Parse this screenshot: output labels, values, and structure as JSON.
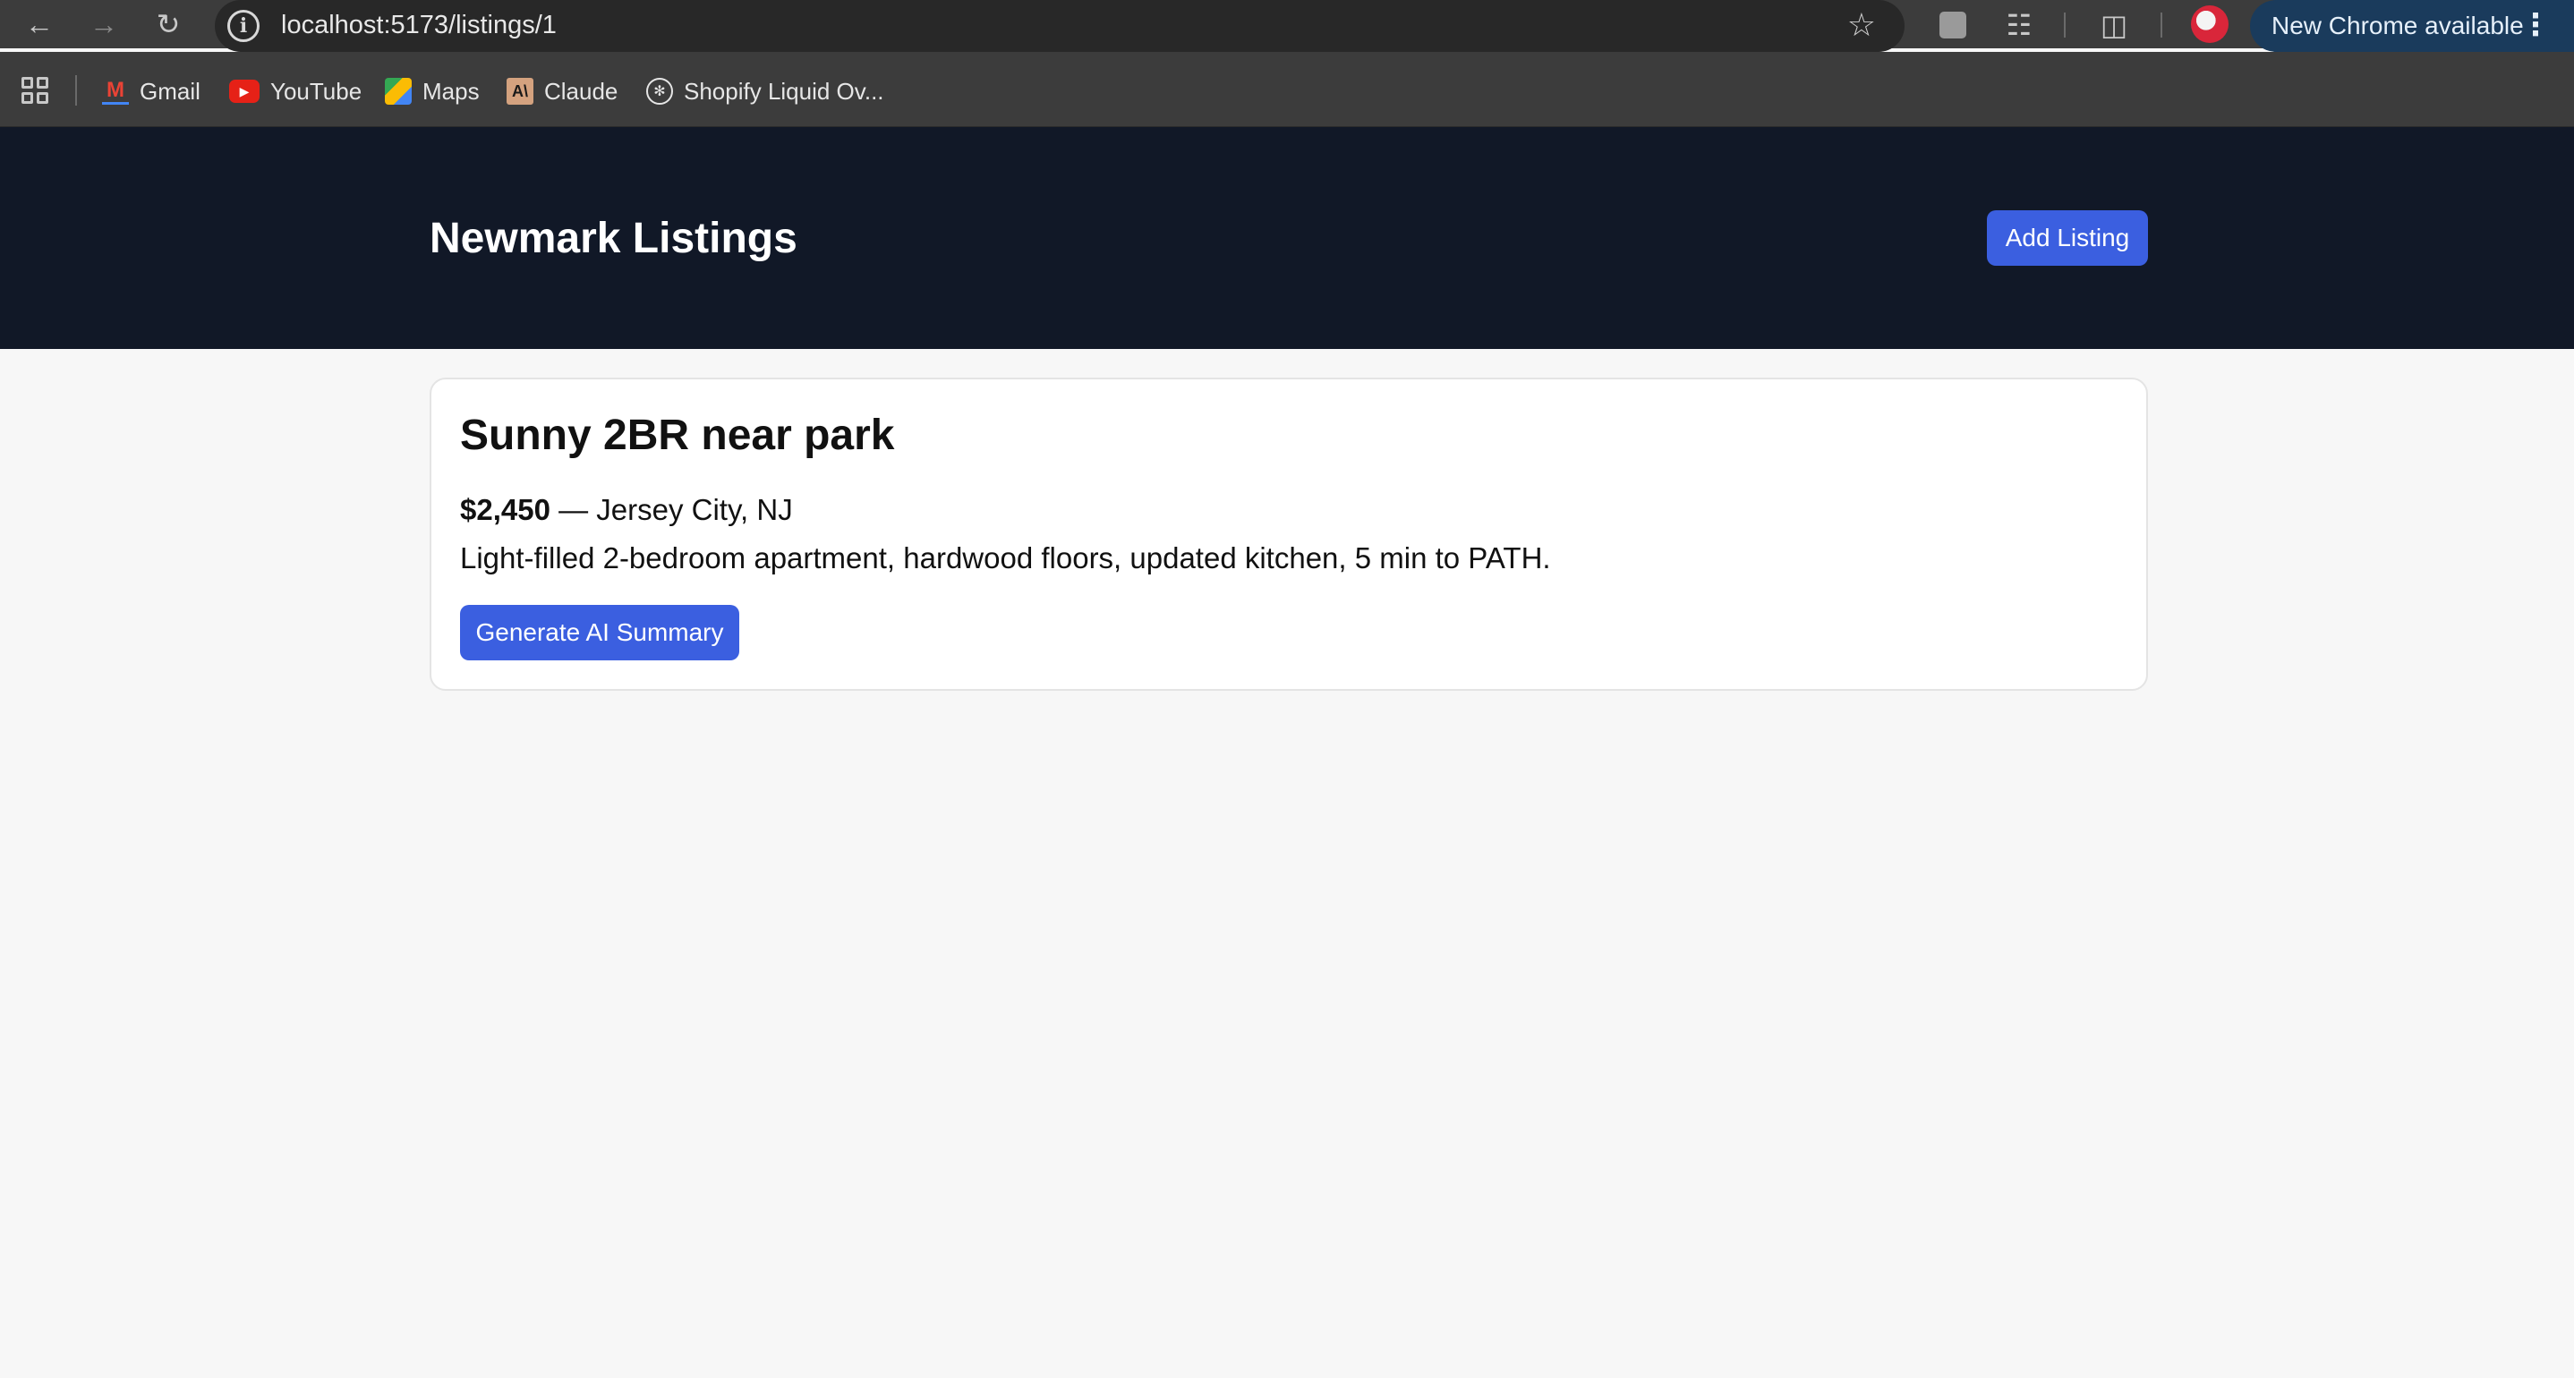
{
  "browser": {
    "url": "localhost:5173/listings/1",
    "update_label": "New Chrome available",
    "bookmarks": [
      {
        "label": "Gmail",
        "icon": "gmail-icon"
      },
      {
        "label": "YouTube",
        "icon": "youtube-icon"
      },
      {
        "label": "Maps",
        "icon": "maps-icon"
      },
      {
        "label": "Claude",
        "icon": "claude-icon"
      },
      {
        "label": "Shopify Liquid Ov...",
        "icon": "shopify-icon"
      }
    ]
  },
  "header": {
    "title": "Newmark Listings",
    "add_label": "Add Listing"
  },
  "listing": {
    "title": "Sunny 2BR near park",
    "price": "$2,450",
    "location": " — Jersey City, NJ",
    "description": "Light-filled 2-bedroom apartment, hardwood floors, updated kitchen, 5 min to PATH.",
    "summary_label": "Generate AI Summary"
  },
  "colors": {
    "header_bg": "#111827",
    "accent": "#3b5fe0",
    "page_bg": "#f7f7f7"
  }
}
